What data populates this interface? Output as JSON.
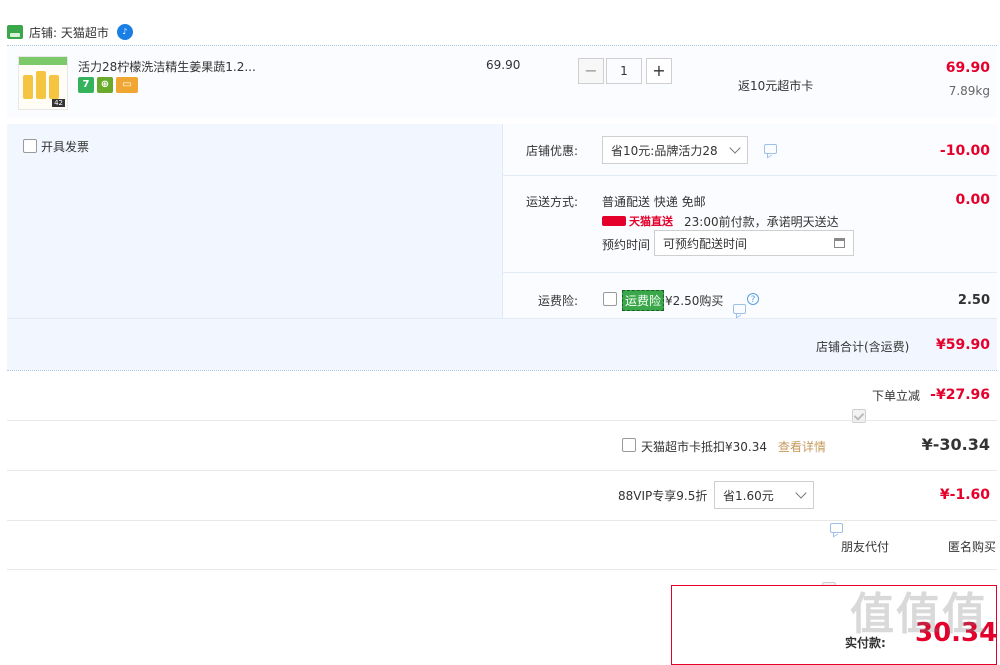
{
  "shop": {
    "label": "店铺: 天猫超市"
  },
  "item": {
    "title": "活力28柠檬洗洁精生姜果蔬1.2...",
    "unit_price": "69.90",
    "quantity": "1",
    "rebate": "返10元超市卡",
    "total": "69.90",
    "weight": "7.89kg",
    "thumb_tag": "42"
  },
  "invoice": {
    "label": "开具发票"
  },
  "shop_discount": {
    "label": "店铺优惠:",
    "selected": "省10元:品牌活力28",
    "amount": "-10.00"
  },
  "shipping": {
    "label": "运送方式:",
    "method": "普通配送 快递 免邮",
    "direct_badge": "天猫直送",
    "promise": "23:00前付款，承诺明天送达",
    "amount": "0.00",
    "schedule_label": "预约时间",
    "schedule_value": "可预约配送时间"
  },
  "insurance": {
    "label": "运费险:",
    "tag": "运费险",
    "price_text": "¥2.50购买",
    "amount": "2.50"
  },
  "shop_total": {
    "label": "店铺合计(含运费)",
    "amount": "¥59.90"
  },
  "instant_discount": {
    "label": "下单立减",
    "amount": "-¥27.96"
  },
  "supermarket_card": {
    "label": "天猫超市卡抵扣¥30.34",
    "link": "查看详情",
    "amount": "¥-30.34"
  },
  "vip": {
    "label": "88VIP专享9.5折",
    "selected": "省1.60元",
    "amount": "¥-1.60"
  },
  "options": {
    "friend_pay": "朋友代付",
    "anonymous": "匿名购买"
  },
  "pay": {
    "label": "实付款:",
    "amount": "30.34"
  },
  "watermark": {
    "text": "值值值"
  },
  "colors": {
    "price_red": "#e4002b",
    "section_bg": "#f2f7ff",
    "checkbox_blue": "#3f7fe0",
    "insurance_green": "#3aa84a"
  }
}
